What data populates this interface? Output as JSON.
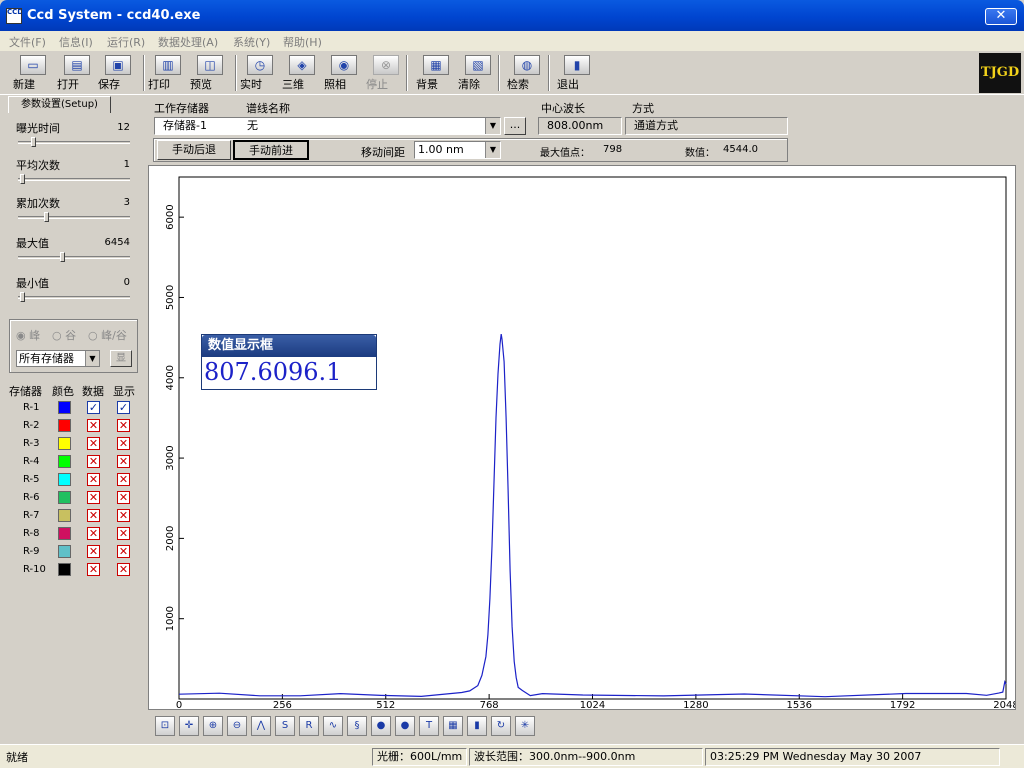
{
  "window": {
    "title": "Ccd System - ccd40.exe",
    "icon": "app-ccd-icon",
    "icon_text": "CCD",
    "close_glyph": "✕"
  },
  "menu": [
    "文件(F)",
    "信息(I)",
    "运行(R)",
    "数据处理(A)",
    "系统(Y)",
    "帮助(H)"
  ],
  "toolbar": [
    {
      "label": "新建",
      "icon": "new-file-icon",
      "glyph": "▭",
      "enabled": true
    },
    {
      "label": "打开",
      "icon": "open-folder-icon",
      "glyph": "▤",
      "enabled": true
    },
    {
      "label": "保存",
      "icon": "save-disk-icon",
      "glyph": "▣",
      "enabled": true
    },
    {
      "label": "打印",
      "icon": "print-icon",
      "glyph": "▥",
      "enabled": true
    },
    {
      "label": "预览",
      "icon": "preview-icon",
      "glyph": "◫",
      "enabled": true
    },
    {
      "label": "实时",
      "icon": "clock-icon",
      "glyph": "◷",
      "enabled": true
    },
    {
      "label": "三维",
      "icon": "3d-icon",
      "glyph": "◈",
      "enabled": true
    },
    {
      "label": "照相",
      "icon": "camera-icon",
      "glyph": "◉",
      "enabled": true
    },
    {
      "label": "停止",
      "icon": "stop-icon",
      "glyph": "⊗",
      "enabled": false
    },
    {
      "label": "背景",
      "icon": "background-icon",
      "glyph": "▦",
      "enabled": true
    },
    {
      "label": "清除",
      "icon": "clear-icon",
      "glyph": "▧",
      "enabled": true
    },
    {
      "label": "检索",
      "icon": "globe-search-icon",
      "glyph": "◍",
      "enabled": true
    },
    {
      "label": "退出",
      "icon": "exit-door-icon",
      "glyph": "▮",
      "enabled": true
    }
  ],
  "logo_text": "TJGD",
  "setup": {
    "tab_label": "参数设置(Setup)",
    "sliders": [
      {
        "label": "曝光时间",
        "value": "12",
        "level": 0.12
      },
      {
        "label": "平均次数",
        "value": "1",
        "level": 0.02
      },
      {
        "label": "累加次数",
        "value": "3",
        "level": 0.25
      },
      {
        "label": "最大值",
        "value": "6454",
        "level": 0.4
      },
      {
        "label": "最小值",
        "value": "0",
        "level": 0.02
      }
    ],
    "radios": [
      "峰",
      "谷",
      "峰/谷"
    ],
    "store_select": "所有存储器",
    "show_button": "显",
    "columns": [
      "存储器",
      "颜色",
      "数据",
      "显示"
    ],
    "memories": [
      {
        "name": "R-1",
        "color": "#0000ff",
        "data": true,
        "show": true
      },
      {
        "name": "R-2",
        "color": "#ff0000",
        "data": false,
        "show": false
      },
      {
        "name": "R-3",
        "color": "#ffff00",
        "data": false,
        "show": false
      },
      {
        "name": "R-4",
        "color": "#00ff00",
        "data": false,
        "show": false
      },
      {
        "name": "R-5",
        "color": "#00ffff",
        "data": false,
        "show": false
      },
      {
        "name": "R-6",
        "color": "#20c060",
        "data": false,
        "show": false
      },
      {
        "name": "R-7",
        "color": "#c8c060",
        "data": false,
        "show": false
      },
      {
        "name": "R-8",
        "color": "#d01060",
        "data": false,
        "show": false
      },
      {
        "name": "R-9",
        "color": "#60c0c8",
        "data": false,
        "show": false
      },
      {
        "name": "R-10",
        "color": "#000000",
        "data": false,
        "show": false
      }
    ],
    "check_on_glyph": "✓",
    "check_off_glyph": "✕"
  },
  "controls": {
    "working_store_label": "工作存储器",
    "spectrum_name_label": "谱线名称",
    "center_wl_label": "中心波长",
    "mode_label": "方式",
    "working_store_value": "存储器-1",
    "spectrum_name_value": "无",
    "browse_button": "...",
    "center_wl_value": "808.00nm",
    "mode_value": "通道方式",
    "back_button": "手动后退",
    "forward_button": "手动前进",
    "step_label": "移动间距",
    "step_value": "1.00 nm",
    "max_point_label": "最大值点：",
    "max_point_value": "798",
    "value_label": "数值：",
    "value_value": "4544.0"
  },
  "value_box": {
    "title": "数值显示框",
    "value": "807.6096.1"
  },
  "chart_tools": [
    "zoom-box-icon",
    "crosshair-icon",
    "zoom-in-icon",
    "zoom-out-icon",
    "peak-icon",
    "s-r-icon",
    "r-equals-icon",
    "waveform-icon",
    "s-curve-icon",
    "red-ball-icon",
    "red-apple-icon",
    "t-w-icon",
    "grid-icon",
    "bar-icon",
    "refresh-icon",
    "sparkle-icon"
  ],
  "chart_tool_glyphs": [
    "⊡",
    "✛",
    "⊕",
    "⊖",
    "⋀",
    "S",
    "R",
    "∿",
    "§",
    "●",
    "●",
    "T",
    "▦",
    "▮",
    "↻",
    "✳"
  ],
  "chart_data": {
    "type": "line",
    "xlim": [
      0,
      2048
    ],
    "ylim": [
      0,
      6500
    ],
    "xticks": [
      0,
      256,
      512,
      768,
      1024,
      1280,
      1536,
      1792,
      2048
    ],
    "yticks": [
      1000,
      2000,
      3000,
      4000,
      5000,
      6000
    ],
    "series": [
      {
        "color": "#1c22c8",
        "x": [
          0,
          100,
          200,
          300,
          400,
          500,
          600,
          700,
          720,
          740,
          750,
          760,
          765,
          770,
          775,
          780,
          785,
          790,
          795,
          798,
          800,
          805,
          810,
          815,
          820,
          825,
          830,
          835,
          840,
          850,
          870,
          900,
          1000,
          1200,
          1400,
          1600,
          1800,
          1950,
          2000,
          2030,
          2040,
          2045,
          2048
        ],
        "y": [
          60,
          55,
          50,
          50,
          50,
          45,
          50,
          70,
          100,
          180,
          280,
          520,
          800,
          1250,
          1900,
          2700,
          3500,
          4050,
          4420,
          4544,
          4480,
          4200,
          3500,
          2600,
          1600,
          900,
          480,
          250,
          140,
          90,
          60,
          50,
          50,
          45,
          50,
          45,
          50,
          55,
          60,
          60,
          100,
          200,
          200
        ]
      }
    ]
  },
  "status": {
    "ready": "就绪",
    "grating": "光栅：600L/mm",
    "range": "波长范围：300.0nm--900.0nm",
    "datetime": "03:25:29 PM  Wednesday May 30 2007"
  }
}
